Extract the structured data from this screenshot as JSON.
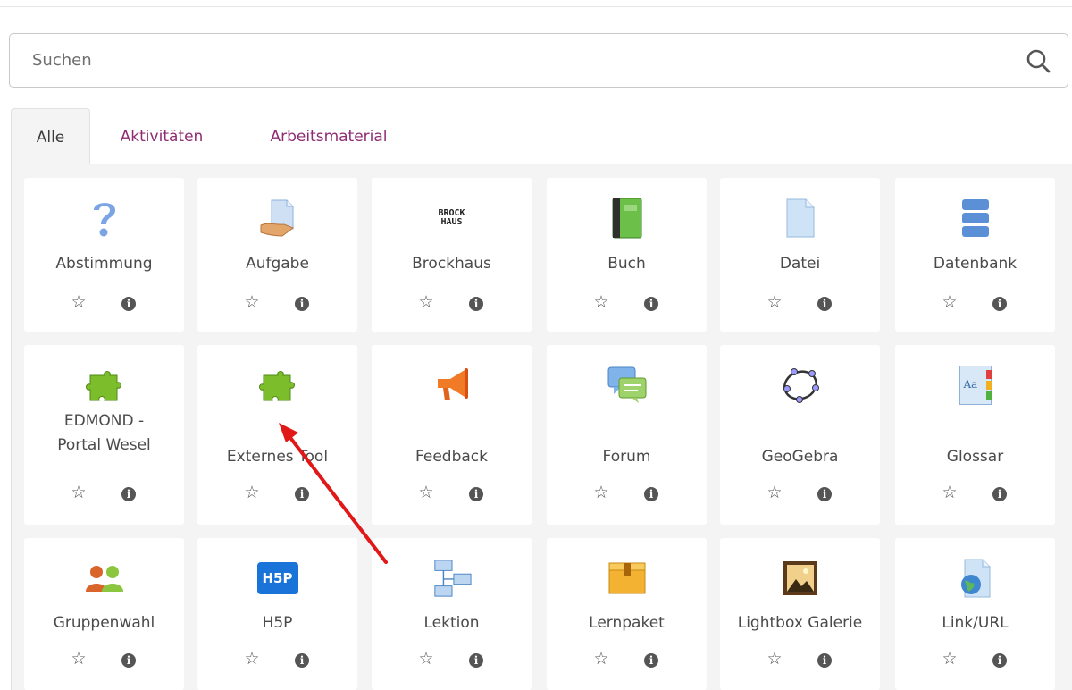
{
  "search": {
    "placeholder": "Suchen",
    "value": ""
  },
  "tabs": [
    {
      "label": "Alle",
      "active": true
    },
    {
      "label": "Aktivitäten",
      "active": false
    },
    {
      "label": "Arbeitsmaterial",
      "active": false
    }
  ],
  "modules": [
    {
      "label": "Abstimmung",
      "icon": "question-icon"
    },
    {
      "label": "Aufgabe",
      "icon": "assignment-icon"
    },
    {
      "label": "Brockhaus",
      "icon": "brockhaus-logo",
      "logo_text": [
        "BROCK",
        "HAUS"
      ]
    },
    {
      "label": "Buch",
      "icon": "book-icon"
    },
    {
      "label": "Datei",
      "icon": "file-icon"
    },
    {
      "label": "Datenbank",
      "icon": "database-icon"
    },
    {
      "label_lines": [
        "EDMOND -",
        "Portal Wesel"
      ],
      "icon": "puzzle-icon"
    },
    {
      "label": "Externes Tool",
      "icon": "puzzle-icon"
    },
    {
      "label": "Feedback",
      "icon": "megaphone-icon"
    },
    {
      "label": "Forum",
      "icon": "speech-bubbles-icon"
    },
    {
      "label": "GeoGebra",
      "icon": "geogebra-icon"
    },
    {
      "label": "Glossar",
      "icon": "glossary-icon",
      "glyph": "Aa"
    },
    {
      "label": "Gruppenwahl",
      "icon": "group-icon"
    },
    {
      "label": "H5P",
      "icon": "h5p-logo",
      "logo_text": "H5P"
    },
    {
      "label": "Lektion",
      "icon": "lesson-icon"
    },
    {
      "label": "Lernpaket",
      "icon": "package-icon"
    },
    {
      "label": "Lightbox Galerie",
      "icon": "image-gallery-icon"
    },
    {
      "label": "Link/URL",
      "icon": "url-icon"
    }
  ],
  "colors": {
    "accent": "#8e2c73",
    "arrow": "#e01818",
    "panel_background": "#f4f4f4"
  }
}
